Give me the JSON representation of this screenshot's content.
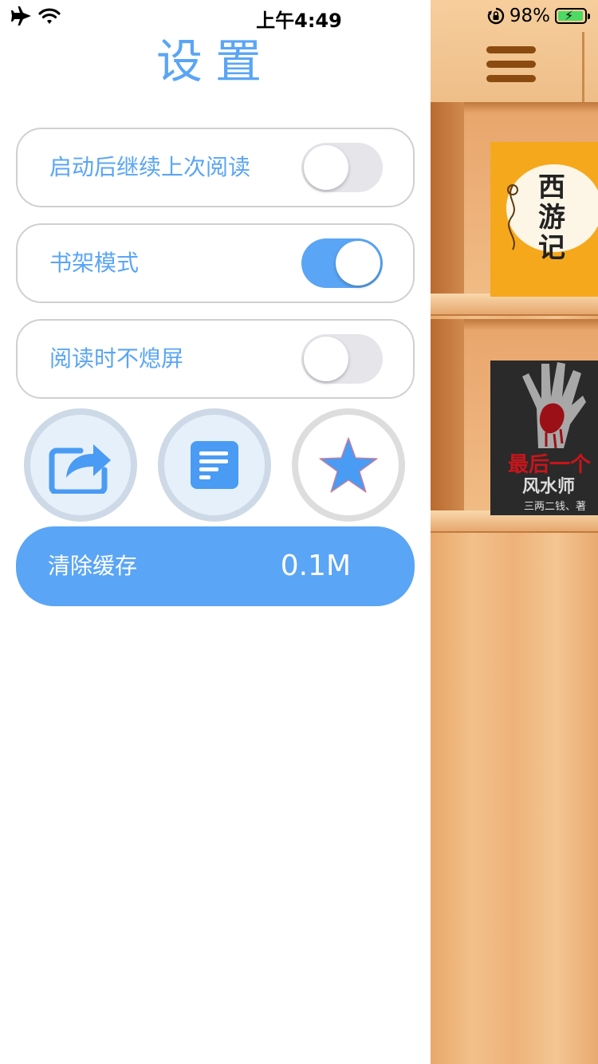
{
  "status_bar": {
    "time": "上午4:49",
    "battery_percent": "98%",
    "battery_level": 0.98,
    "icons": [
      "airplane-icon",
      "wifi-icon",
      "rotation-lock-icon",
      "battery-icon"
    ]
  },
  "settings": {
    "title": "设置",
    "toggles": [
      {
        "label": "启动后继续上次阅读",
        "on": false
      },
      {
        "label": "书架模式",
        "on": true
      },
      {
        "label": "阅读时不熄屏",
        "on": false
      }
    ],
    "action_buttons": [
      "share-icon",
      "document-icon",
      "star-icon"
    ],
    "clear_cache": {
      "label": "清除缓存",
      "size": "0.1M"
    }
  },
  "bookshelf": {
    "menu_icon": "hamburger-menu-icon",
    "books": [
      {
        "title": "西游记"
      },
      {
        "title_line1": "最后一个",
        "title_line2": "风水师",
        "author": "三两二钱、著"
      }
    ]
  },
  "colors": {
    "accent": "#5aa5f5",
    "switch_off": "#e5e5ea",
    "row_border": "#d0d0d0",
    "wood": "#eeb27a"
  }
}
